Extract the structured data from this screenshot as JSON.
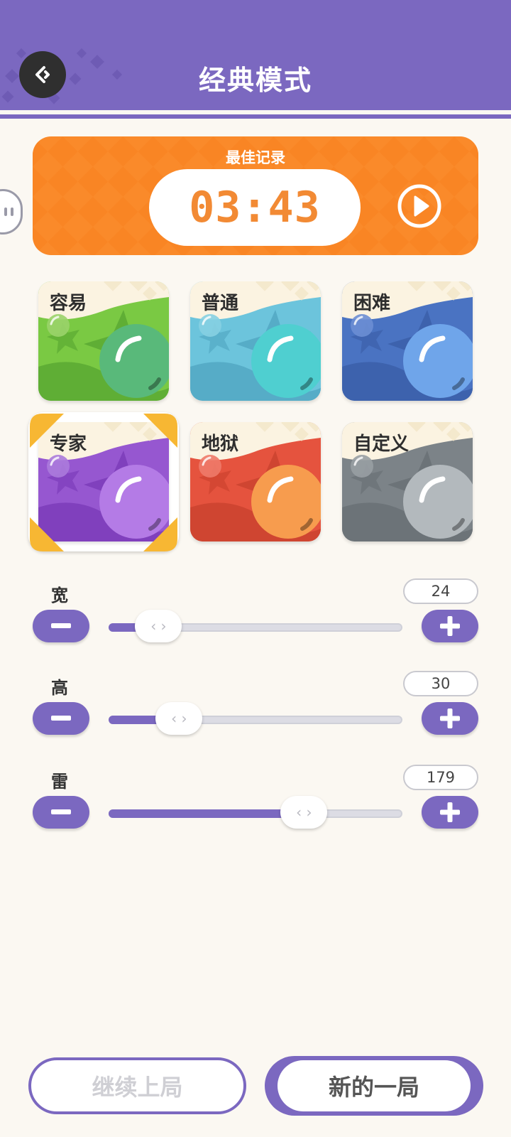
{
  "header": {
    "title": "经典模式"
  },
  "best": {
    "label": "最佳记录",
    "time": "03:43"
  },
  "difficulties": [
    {
      "label": "容易",
      "base": "#7ac943",
      "wave": "#5fae35",
      "ball": "#59b97a",
      "small": "#9ad36a"
    },
    {
      "label": "普通",
      "base": "#6cc4dc",
      "wave": "#56acc7",
      "ball": "#4fcfd0",
      "small": "#86d0e2"
    },
    {
      "label": "困难",
      "base": "#4a73c2",
      "wave": "#3d62ad",
      "ball": "#6fa5ea",
      "small": "#6c8ed4"
    },
    {
      "label": "专家",
      "base": "#9657d0",
      "wave": "#8040bd",
      "ball": "#b47be6",
      "small": "#ab7bdb"
    },
    {
      "label": "地狱",
      "base": "#e5533e",
      "wave": "#cf4531",
      "ball": "#f79c4e",
      "small": "#ee7a69"
    },
    {
      "label": "自定义",
      "base": "#7c8388",
      "wave": "#6c7378",
      "ball": "#b3b9bd",
      "small": "#989ea3"
    }
  ],
  "selected_difficulty": "专家",
  "sliders": [
    {
      "label": "宽",
      "value": "24",
      "fraction": 0.17
    },
    {
      "label": "高",
      "value": "30",
      "fraction": 0.24
    },
    {
      "label": "雷",
      "value": "179",
      "fraction": 0.665
    }
  ],
  "buttons": {
    "continue": "继续上局",
    "new_game": "新的一局"
  },
  "colors": {
    "accent": "#7b68c0",
    "orange": "#fa8a2a",
    "highlight": "#f7b733"
  }
}
